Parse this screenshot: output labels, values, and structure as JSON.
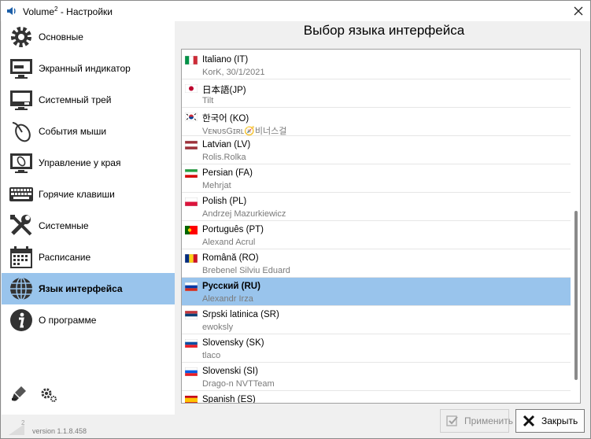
{
  "window": {
    "title": "Volume",
    "title_sup": "2",
    "title_suffix": " - Настройки"
  },
  "sidebar": {
    "items": [
      {
        "label": "Основные",
        "icon": "gear-icon"
      },
      {
        "label": "Экранный индикатор",
        "icon": "monitor-icon"
      },
      {
        "label": "Системный трей",
        "icon": "tray-icon"
      },
      {
        "label": "События мыши",
        "icon": "mouse-icon"
      },
      {
        "label": "Управление у края",
        "icon": "screen-edge-icon"
      },
      {
        "label": "Горячие клавиши",
        "icon": "keyboard-icon"
      },
      {
        "label": "Системные",
        "icon": "tools-icon"
      },
      {
        "label": "Расписание",
        "icon": "calendar-icon"
      },
      {
        "label": "Язык интерфейса",
        "icon": "globe-icon"
      },
      {
        "label": "О программе",
        "icon": "info-icon"
      }
    ],
    "active_index": 8
  },
  "version": {
    "logo_sup": "2",
    "text": "version 1.1.8.458"
  },
  "content": {
    "title": "Выбор языка интерфейса"
  },
  "languages": [
    {
      "name": "Italiano (IT)",
      "author": "KorK, 30/1/2021",
      "flag": [
        "#009246",
        "#ffffff",
        "#ce2b37"
      ],
      "flag_dir": "v"
    },
    {
      "name": "日本語(JP)",
      "author": "Tilt",
      "flag": "jp"
    },
    {
      "name": "한국어 (KO)",
      "author": "VᴇɴᴜsGɪʀʟ🧭비너스걸",
      "flag": "ko"
    },
    {
      "name": "Latvian (LV)",
      "author": "Rolis.Rolka",
      "flag": [
        "#9e3039",
        "#ffffff",
        "#9e3039"
      ],
      "flag_dir": "h"
    },
    {
      "name": "Persian (FA)",
      "author": "Mehrjat",
      "flag": [
        "#239f40",
        "#ffffff",
        "#da0000"
      ],
      "flag_dir": "h"
    },
    {
      "name": "Polish (PL)",
      "author": "Andrzej Mazurkiewicz",
      "flag": [
        "#ffffff",
        "#dc143c"
      ],
      "flag_dir": "h"
    },
    {
      "name": "Português (PT)",
      "author": "Alexand Acrul",
      "flag": "pt"
    },
    {
      "name": "Română (RO)",
      "author": "Brebenel Silviu Eduard",
      "flag": [
        "#002b7f",
        "#fcd116",
        "#ce1126"
      ],
      "flag_dir": "v"
    },
    {
      "name": "Русский (RU)",
      "author": "Alexandr Irza",
      "flag": [
        "#ffffff",
        "#0039a6",
        "#d52b1e"
      ],
      "flag_dir": "h",
      "selected": true
    },
    {
      "name": "Srpski latinica (SR)",
      "author": "ewoksly",
      "flag": [
        "#c6363c",
        "#0c4076",
        "#ffffff"
      ],
      "flag_dir": "h"
    },
    {
      "name": "Slovensky (SK)",
      "author": "tlaco",
      "flag": [
        "#ffffff",
        "#0b4ea2",
        "#ee1c25"
      ],
      "flag_dir": "h"
    },
    {
      "name": "Slovenski (SI)",
      "author": "Drago-n NVTTeam",
      "flag": [
        "#ffffff",
        "#005ce5",
        "#ed1c24"
      ],
      "flag_dir": "h"
    },
    {
      "name": "Spanish (ES)",
      "author": "",
      "flag": "es"
    }
  ],
  "buttons": {
    "apply_label": "Применить",
    "close_label": "Закрыть"
  },
  "colors": {
    "selection": "#99c4ec",
    "window_bg": "#f0f0f0"
  }
}
